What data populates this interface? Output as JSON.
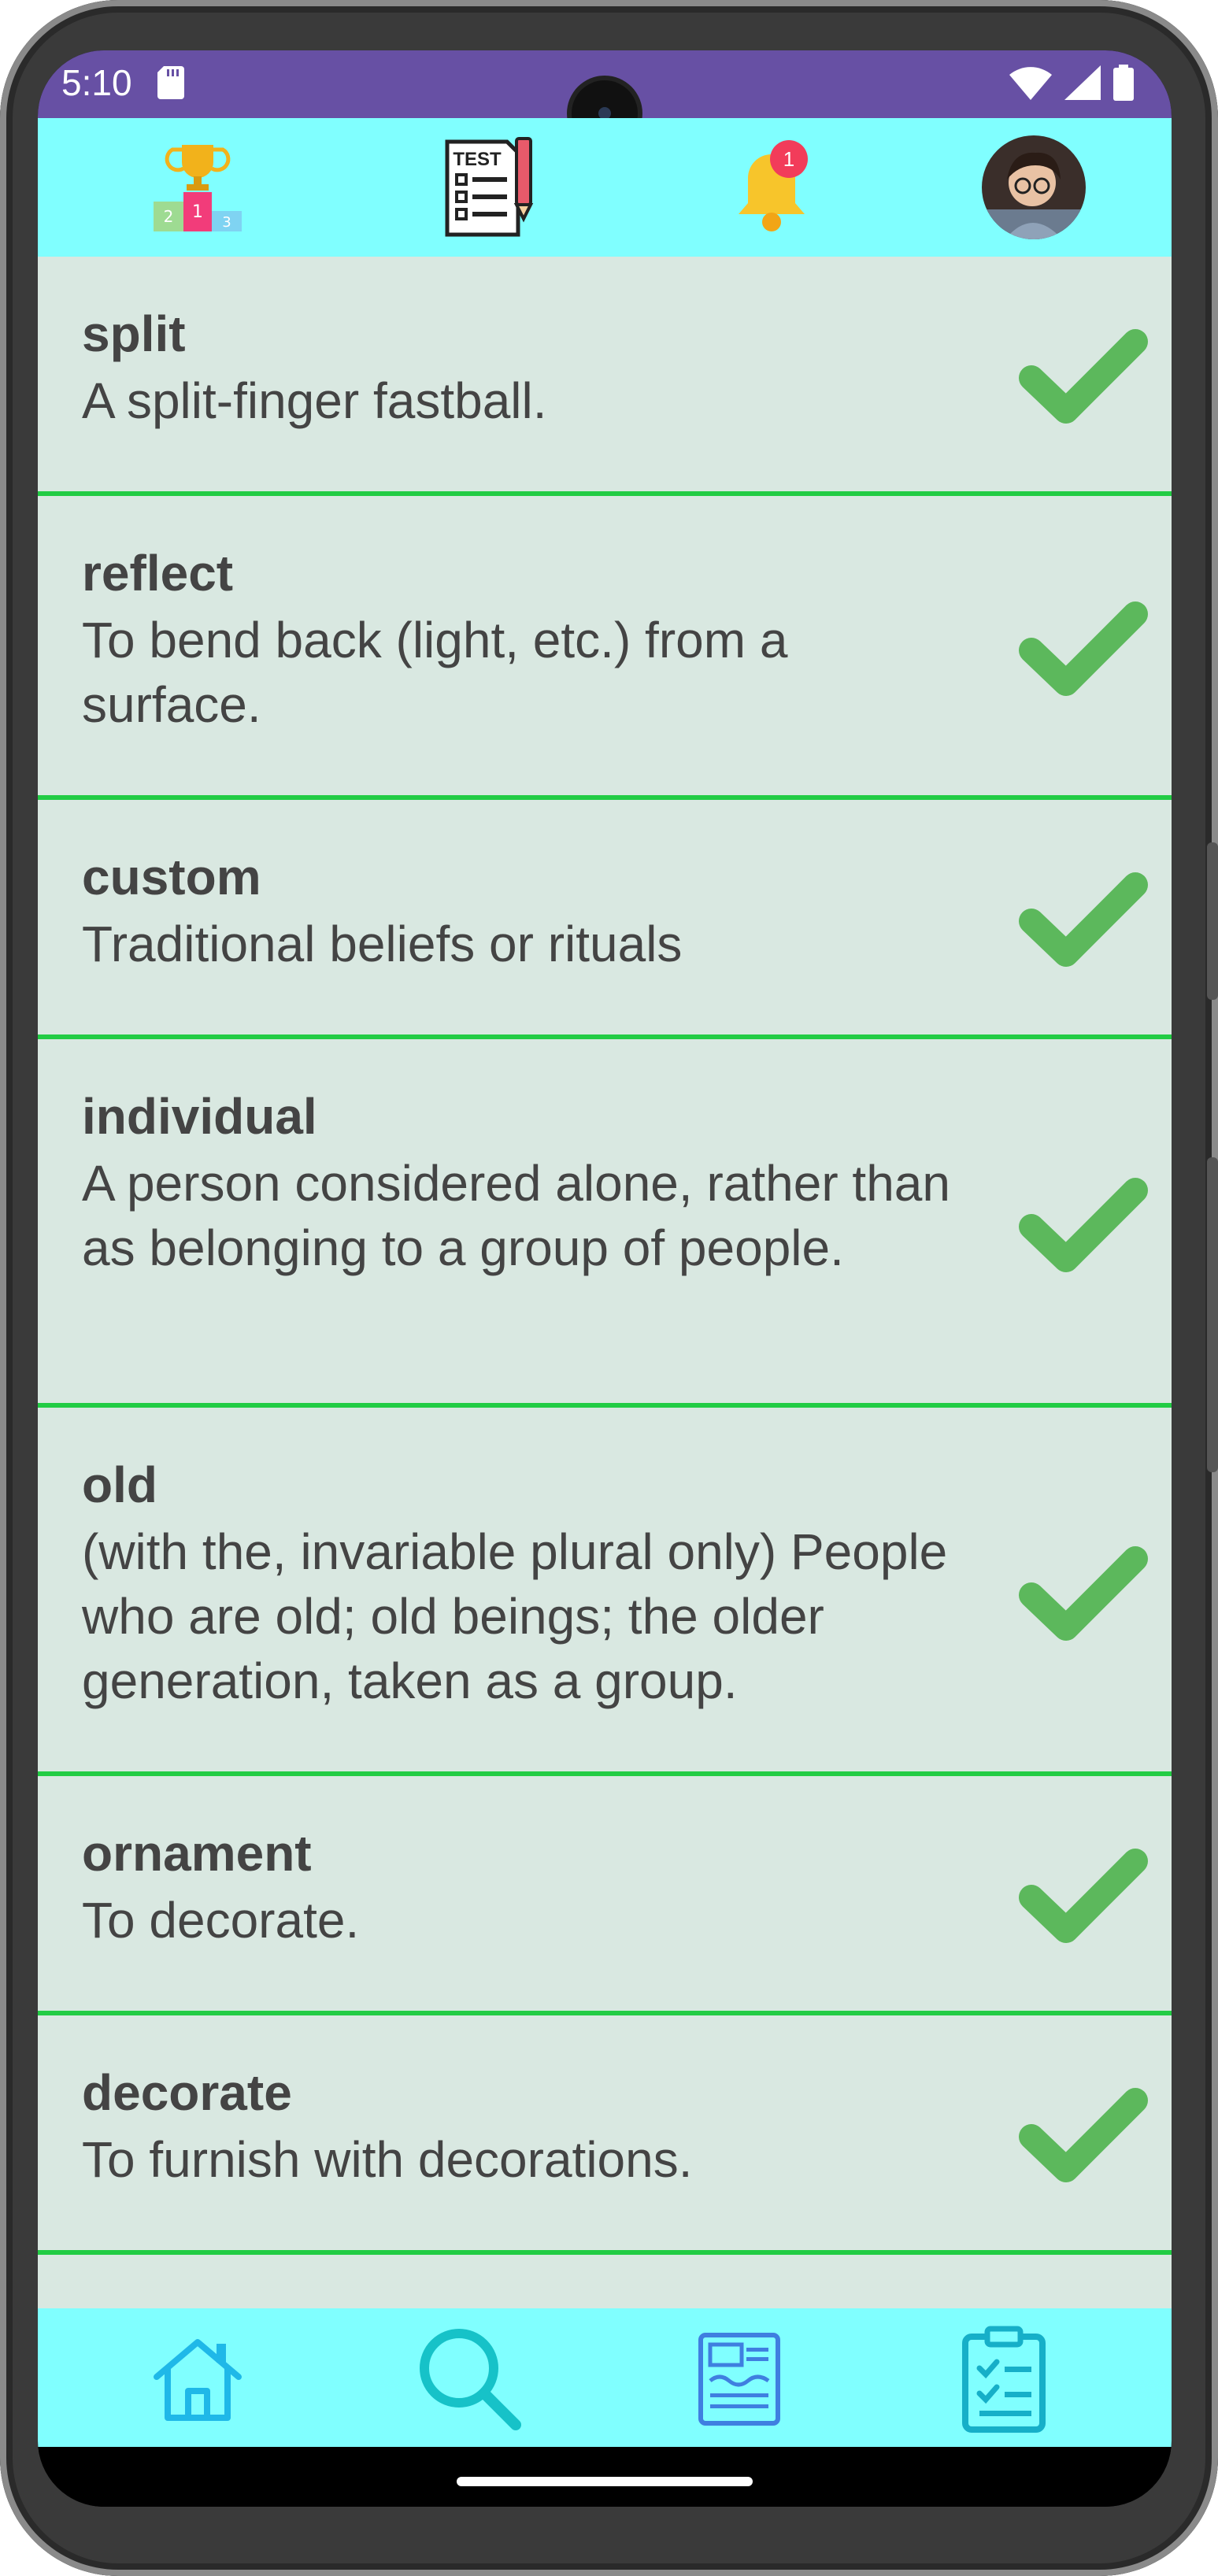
{
  "status_bar": {
    "time": "5:10",
    "icons": [
      "sd-card-icon",
      "wifi-icon",
      "signal-icon",
      "battery-icon"
    ]
  },
  "top_bar": {
    "items": [
      {
        "icon": "leaderboard-trophy-icon"
      },
      {
        "icon": "test-checklist-icon",
        "label": "TEST"
      },
      {
        "icon": "notification-bell-icon",
        "badge": "1"
      },
      {
        "icon": "profile-avatar-icon"
      }
    ]
  },
  "words": [
    {
      "word": "split",
      "definition": "A split-finger fastball.",
      "learned": true
    },
    {
      "word": "reflect",
      "definition": "To bend back (light, etc.) from a surface.",
      "learned": true
    },
    {
      "word": "custom",
      "definition": "Traditional beliefs or rituals",
      "learned": true
    },
    {
      "word": "individual",
      "definition": "A person considered alone, rather than as belonging to a group of people.",
      "learned": true
    },
    {
      "word": "old",
      "definition": "(with the, invariable plural only) People who are old; old beings; the older generation, taken as a group.",
      "learned": true
    },
    {
      "word": "ornament",
      "definition": "To decorate.",
      "learned": true
    },
    {
      "word": "decorate",
      "definition": "To furnish with decorations.",
      "learned": true
    }
  ],
  "bottom_nav": {
    "items": [
      {
        "icon": "home-icon"
      },
      {
        "icon": "search-icon"
      },
      {
        "icon": "news-icon"
      },
      {
        "icon": "clipboard-checklist-icon"
      }
    ]
  },
  "colors": {
    "status_bar": "#6750A4",
    "top_bar": "#80FFFF",
    "list_background": "#D9E8E1",
    "divider": "#22CC44",
    "check": "#5CB85C",
    "text": "#444444"
  }
}
